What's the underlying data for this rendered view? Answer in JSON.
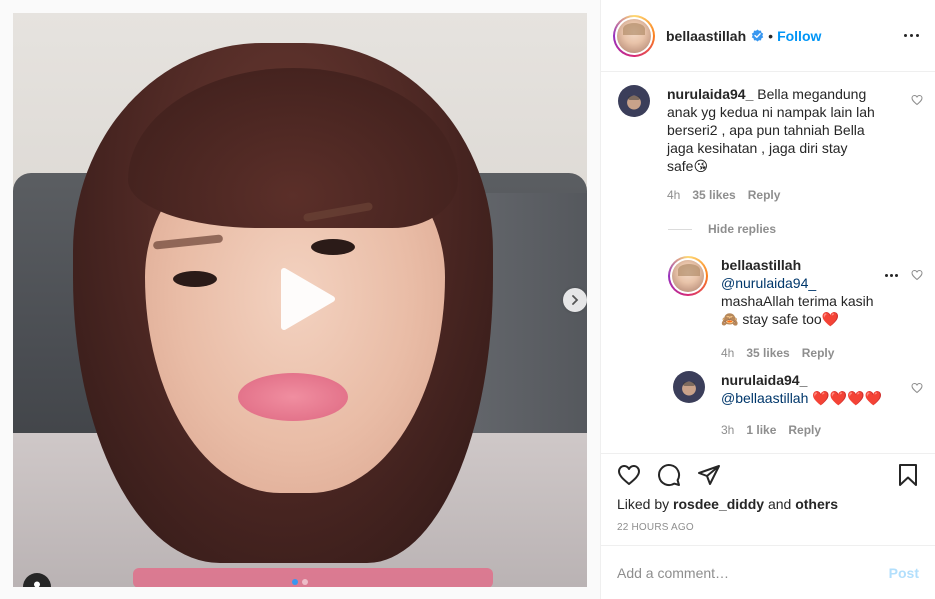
{
  "post": {
    "author": "bellaastillah",
    "follow_label": "Follow",
    "separator": "•"
  },
  "comments": [
    {
      "user": "nurulaida94_",
      "text_lines": [
        "Bella megandung",
        "anak yg kedua ni nampak lain lah",
        "berseri2 , apa pun tahniah Bella",
        "jaga kesihatan , jaga diri stay",
        "safe😘"
      ],
      "time": "4h",
      "likes": "35 likes",
      "reply_label": "Reply"
    }
  ],
  "hide_replies_label": "Hide replies",
  "replies": [
    {
      "user": "bellaastillah",
      "mention": "@nurulaida94_",
      "text_lines": [
        "mashaAllah terima kasih",
        "🙈 stay safe too❤️"
      ],
      "time": "4h",
      "likes": "35 likes",
      "reply_label": "Reply"
    },
    {
      "user": "nurulaida94_",
      "mention": "@bellaastillah",
      "text_suffix": " ❤️❤️❤️❤️",
      "time": "3h",
      "likes": "1 like",
      "reply_label": "Reply"
    }
  ],
  "liked_by": {
    "prefix": "Liked by ",
    "user": "rosdee_diddy",
    "middle": " and ",
    "others": "others"
  },
  "time_ago": "22 HOURS AGO",
  "add_comment": {
    "placeholder": "Add a comment…",
    "post_label": "Post"
  },
  "colors": {
    "link_blue": "#0095f6",
    "mention_blue": "#00376b",
    "muted": "#8e8e8e",
    "post_disabled": "#b2dffc"
  }
}
